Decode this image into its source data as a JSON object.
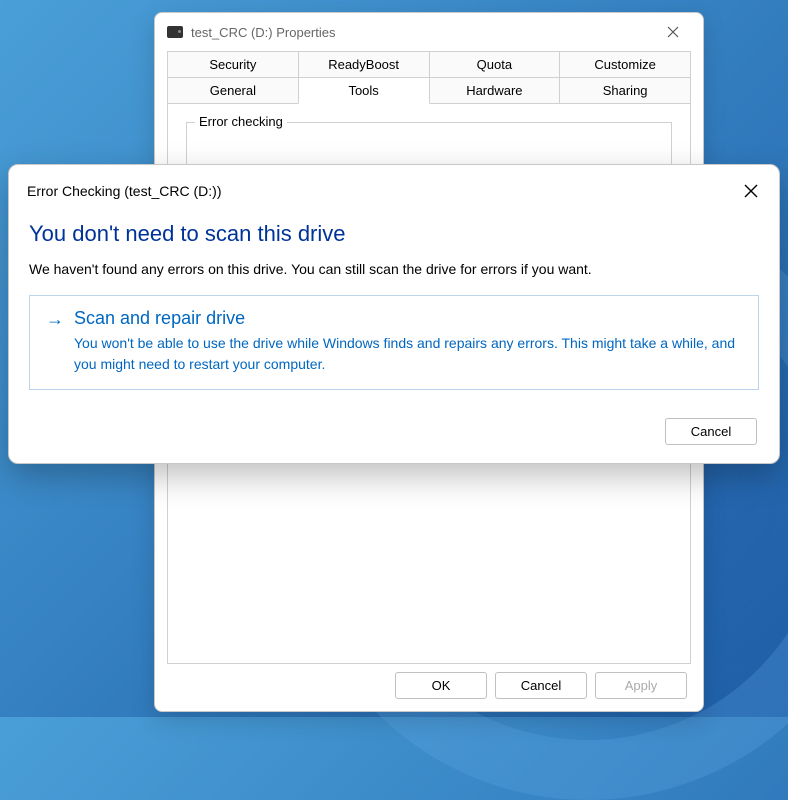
{
  "properties": {
    "title": "test_CRC (D:) Properties",
    "tabs_row1": [
      "Security",
      "ReadyBoost",
      "Quota",
      "Customize"
    ],
    "tabs_row2": [
      "General",
      "Tools",
      "Hardware",
      "Sharing"
    ],
    "active_tab": "Tools",
    "group_label": "Error checking",
    "buttons": {
      "ok": "OK",
      "cancel": "Cancel",
      "apply": "Apply"
    }
  },
  "dialog": {
    "title": "Error Checking (test_CRC (D:))",
    "heading": "You don't need to scan this drive",
    "body": "We haven't found any errors on this drive. You can still scan the drive for errors if you want.",
    "command": {
      "title": "Scan and repair drive",
      "description": "You won't be able to use the drive while Windows finds and repairs any errors. This might take a while, and you might need to restart your computer."
    },
    "cancel": "Cancel"
  }
}
